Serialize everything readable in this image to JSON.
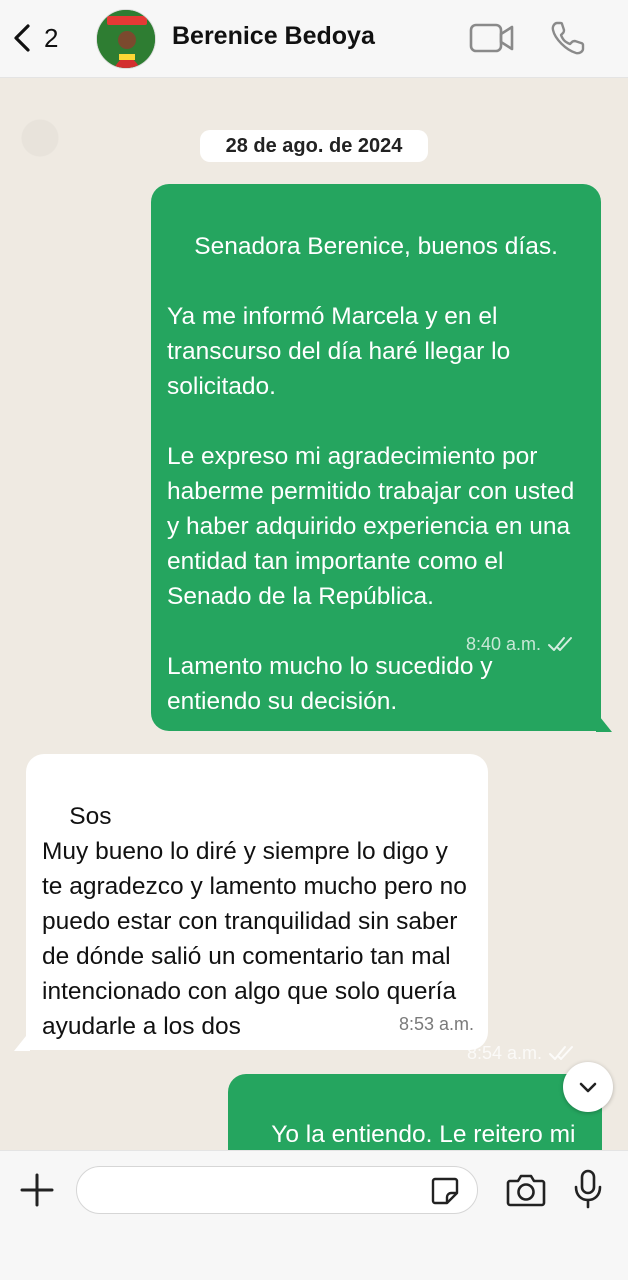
{
  "header": {
    "back_count": "2",
    "contact_name": "Berenice Bedoya",
    "avatar_icon": "profile-photo",
    "video_icon": "video-camera-icon",
    "phone_icon": "phone-icon"
  },
  "chat": {
    "date": "28 de ago. de 2024",
    "messages": [
      {
        "direction": "outgoing",
        "text": "Senadora Berenice, buenos días.\n\nYa me informó Marcela y en el transcurso del día haré llegar lo solicitado.\n\nLe expreso mi agradecimiento por haberme permitido trabajar con usted y haber adquirido experiencia en una entidad tan importante como el Senado de la República.\n\nLamento mucho lo sucedido y entiendo su decisión.",
        "time": "8:40 a.m.",
        "status": "read"
      },
      {
        "direction": "incoming",
        "text": "Sos\nMuy bueno lo diré y siempre lo digo y te agradezco y lamento mucho pero no puedo estar con tranquilidad sin saber de dónde salió un comentario tan mal intencionado con algo que solo quería ayudarle a los dos",
        "time": "8:53 a.m."
      },
      {
        "direction": "outgoing",
        "text": "Yo la entiendo. Le reitero mi agradecimiento.",
        "time": "8:54 a.m.",
        "status": "read"
      }
    ]
  },
  "composer": {
    "input_value": "",
    "plus_icon": "plus-icon",
    "sticker_icon": "sticker-icon",
    "camera_icon": "camera-icon",
    "mic_icon": "microphone-icon"
  },
  "colors": {
    "outgoing_bubble": "#25a55f",
    "incoming_bubble": "#ffffff",
    "chat_background": "#efeae2"
  }
}
